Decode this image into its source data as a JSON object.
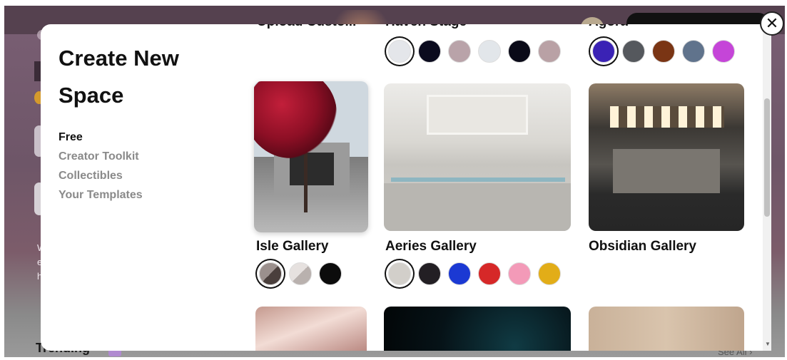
{
  "background": {
    "side_text": "W\ne\nh",
    "trending_label": "Trending",
    "see_all_label": "See All ›"
  },
  "modal": {
    "title": "Create New Space",
    "close_glyph": "✕",
    "categories": [
      {
        "label": "Free",
        "active": true
      },
      {
        "label": "Creator Toolkit",
        "active": false
      },
      {
        "label": "Collectibles",
        "active": false
      },
      {
        "label": "Your Templates",
        "active": false
      }
    ],
    "templates_top_row": [
      {
        "label": "Upload Custo...",
        "swatches": []
      },
      {
        "label": "Haven Stage",
        "swatches": [
          "#e4e6ea",
          "#0b0b1e",
          "#b9a3a9",
          "#e2e6ea",
          "#0a0a18",
          "#b9a1a5"
        ],
        "selected": 0
      },
      {
        "label": "Agora",
        "swatches": [
          "#3a22b5",
          "#55585d",
          "#7a3514",
          "#60738c",
          "#c545d8"
        ],
        "selected": 0
      }
    ],
    "templates_mid_row": [
      {
        "label": "Isle Gallery",
        "swatches": [
          "#6b5f5c",
          "#cfc8c6",
          "#0c0c0c"
        ],
        "selected": 0
      },
      {
        "label": "Aeries Gallery",
        "swatches": [
          "#d2cfca",
          "#231f24",
          "#1b39d3",
          "#d62828",
          "#f39ab8",
          "#e2ad18"
        ],
        "selected": 0
      },
      {
        "label": "Obsidian Gallery",
        "swatches": [],
        "selected": -1
      }
    ]
  }
}
